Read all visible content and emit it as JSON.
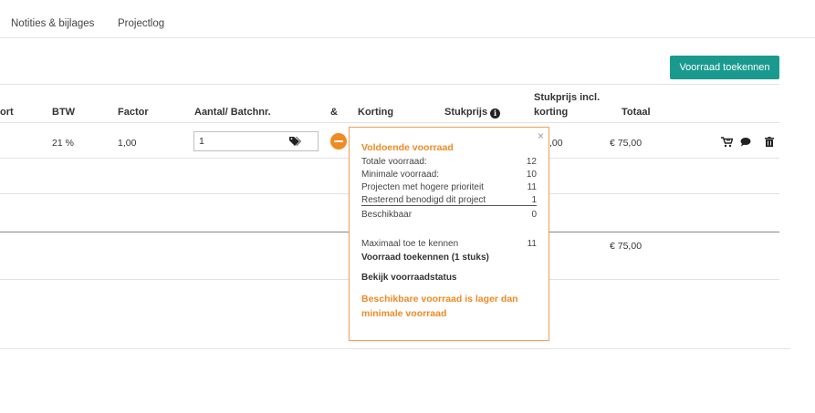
{
  "tabs": [
    {
      "label": "Notities & bijlages"
    },
    {
      "label": "Projectlog"
    }
  ],
  "actions": {
    "allocate_stock": "Voorraad toekennen"
  },
  "table": {
    "headers": {
      "col_partial": "ort",
      "vat": "BTW",
      "factor": "Factor",
      "qty": "Aantal/ Batchnr.",
      "amp": "&",
      "discount": "Korting",
      "unit_price": "Stukprijs",
      "unit_price_incl_line1": "Stukprijs incl.",
      "unit_price_incl_line2": "korting",
      "total": "Totaal"
    },
    "row": {
      "vat": "21 %",
      "factor": "1,00",
      "qty": "1",
      "unit_price_incl": ",00",
      "total": "€ 75,00"
    },
    "subtotal": "€ 75,00"
  },
  "popover": {
    "title": "Voldoende voorraad",
    "rows": [
      {
        "label": "Totale voorraad:",
        "value": "12"
      },
      {
        "label": "Minimale voorraad:",
        "value": "10"
      },
      {
        "label": "Projecten met hogere prioriteit",
        "value": "11"
      },
      {
        "label": "Resterend benodigd dit project",
        "value": "1"
      },
      {
        "label": "Beschikbaar",
        "value": "0"
      }
    ],
    "max_label": "Maximaal toe te kennen",
    "max_value": "11",
    "allocate_link": "Voorraad toekennen (1 stuks)",
    "status_link": "Bekijk voorraadstatus",
    "warning": "Beschikbare voorraad is lager dan minimale voorraad",
    "close": "×"
  },
  "colors": {
    "accent": "#1a9a8e",
    "warning": "#f08a24"
  }
}
